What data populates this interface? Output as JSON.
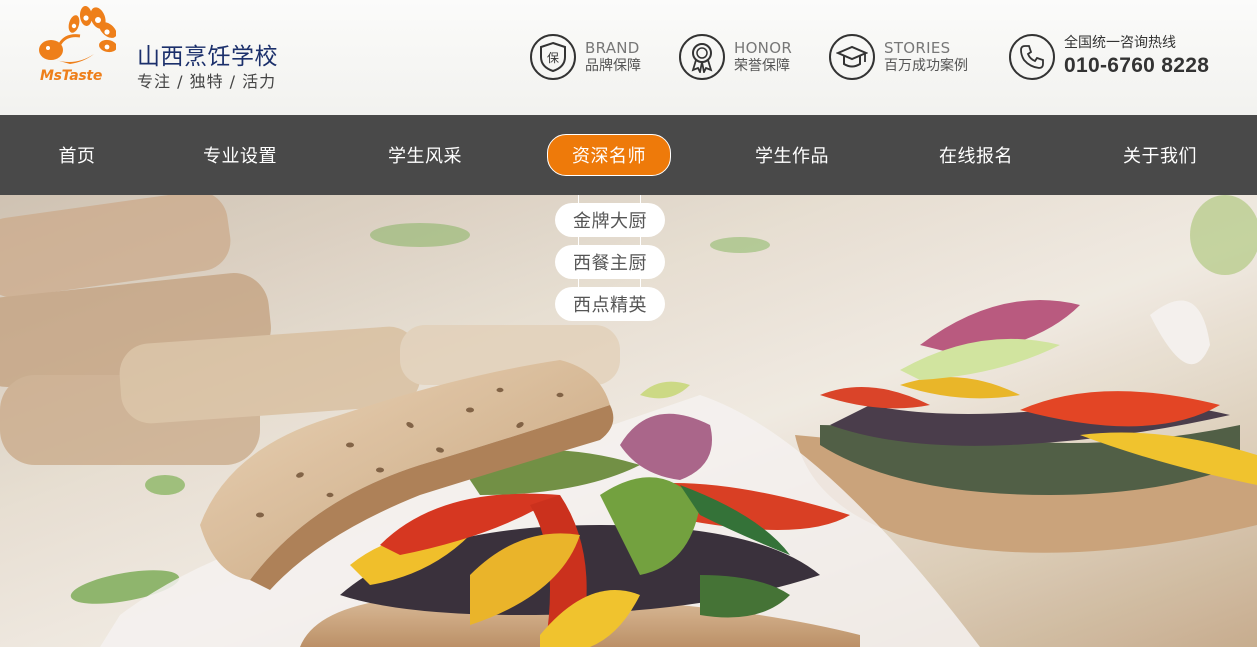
{
  "header": {
    "logo_text": "MsTaste",
    "school_name": "山西烹饪学校",
    "slogan": "专注 / 独特 / 活力",
    "badges": [
      {
        "icon": "shield-icon",
        "icon_text": "保",
        "en": "BRAND",
        "cn": "品牌保障"
      },
      {
        "icon": "medal-icon",
        "en": "HONOR",
        "cn": "荣誉保障"
      },
      {
        "icon": "graduation-cap-icon",
        "en": "STORIES",
        "cn": "百万成功案例"
      }
    ],
    "hotline": {
      "icon": "phone-icon",
      "label": "全国统一咨询热线",
      "number": "010-6760 8228"
    }
  },
  "nav": {
    "items": [
      {
        "label": "首页"
      },
      {
        "label": "专业设置"
      },
      {
        "label": "学生风采"
      },
      {
        "label": "资深名师",
        "active": true
      },
      {
        "label": "学生作品"
      },
      {
        "label": "在线报名"
      },
      {
        "label": "关于我们"
      }
    ],
    "dropdown": [
      "金牌大厨",
      "西餐主厨",
      "西点精英"
    ]
  },
  "colors": {
    "accent": "#ee7a0a",
    "nav_bg": "#494949",
    "school_name": "#1b2f6b",
    "logo": "#ee7f1a"
  }
}
